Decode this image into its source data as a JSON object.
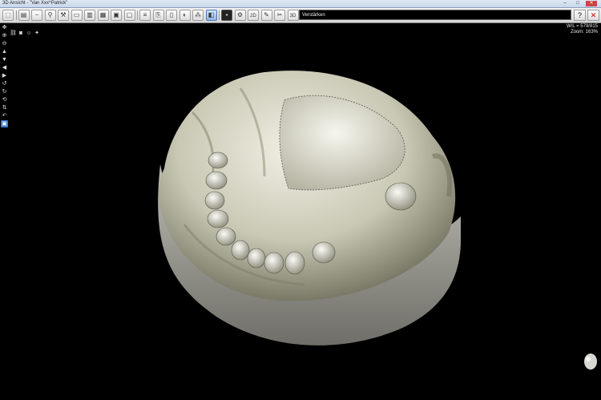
{
  "window": {
    "title": "3D Ansicht - \"Van Xxx^Patrick\""
  },
  "toolbar": {
    "buttons": [
      {
        "name": "select-tool-button",
        "icon": "cursor-icon",
        "glyph": "⬚"
      },
      {
        "name": "layout-button",
        "icon": "layout-icon",
        "glyph": "▤"
      },
      {
        "name": "ruler-button",
        "icon": "ruler-icon",
        "glyph": "⎯"
      },
      {
        "name": "zoom-button",
        "icon": "zoom-icon",
        "glyph": "⚲"
      },
      {
        "name": "tools-button",
        "icon": "wrench-icon",
        "glyph": "⚒"
      },
      {
        "name": "panorama-button",
        "icon": "panorama-icon",
        "glyph": "▭"
      },
      {
        "name": "slice-button",
        "icon": "slice-icon",
        "glyph": "▥"
      },
      {
        "name": "series-button",
        "icon": "series-icon",
        "glyph": "▦"
      },
      {
        "name": "window-button",
        "icon": "window-icon",
        "glyph": "▣"
      },
      {
        "name": "screen-button",
        "icon": "monitor-icon",
        "glyph": "▢"
      },
      {
        "name": "stack-button",
        "icon": "stack-icon",
        "glyph": "≡"
      },
      {
        "name": "export-button",
        "icon": "export-icon",
        "glyph": "⎘"
      },
      {
        "name": "page-button",
        "icon": "page-icon",
        "glyph": "▯"
      },
      {
        "name": "contrast-button",
        "icon": "contrast-icon",
        "glyph": "◐"
      },
      {
        "name": "molecule-button",
        "icon": "molecule-icon",
        "glyph": "⁂"
      },
      {
        "name": "volume-button",
        "icon": "cube-icon",
        "glyph": "◧"
      },
      {
        "name": "preview-button",
        "icon": "thumbnail-icon",
        "glyph": "▪"
      },
      {
        "name": "settings-button",
        "icon": "gear-icon",
        "glyph": "⚙"
      },
      {
        "name": "2d-button",
        "icon": "2d-icon",
        "glyph": "2D"
      },
      {
        "name": "report-button",
        "icon": "report-icon",
        "glyph": "✎"
      },
      {
        "name": "tools2-button",
        "icon": "scissors-icon",
        "glyph": "✂"
      },
      {
        "name": "3d-button",
        "icon": "3d-icon",
        "glyph": "3D"
      }
    ],
    "hint": "Verstärken"
  },
  "right_buttons": {
    "help": "?",
    "close": "✕"
  },
  "side_tools": [
    {
      "name": "arrows-tool",
      "glyph": "✥"
    },
    {
      "name": "zoom-in-tool",
      "glyph": "⊕"
    },
    {
      "name": "zoom-out-tool",
      "glyph": "⊖"
    },
    {
      "name": "up-tool",
      "glyph": "▲"
    },
    {
      "name": "down-tool",
      "glyph": "▼"
    },
    {
      "name": "left-tool",
      "glyph": "◀"
    },
    {
      "name": "right-tool",
      "glyph": "▶"
    },
    {
      "name": "rotate-left-tool",
      "glyph": "↺"
    },
    {
      "name": "rotate-right-tool",
      "glyph": "↻"
    },
    {
      "name": "reset-tool",
      "glyph": "⟲"
    },
    {
      "name": "flip-tool",
      "glyph": "⇅"
    },
    {
      "name": "undo-tool",
      "glyph": "↶"
    },
    {
      "name": "color-tool",
      "glyph": "▣",
      "blue": true
    }
  ],
  "mini_icons": [
    {
      "name": "link-icon",
      "glyph": "⛓"
    },
    {
      "name": "camera-icon",
      "glyph": "◙"
    },
    {
      "name": "person-icon",
      "glyph": "☺"
    },
    {
      "name": "tool-icon",
      "glyph": "✦"
    }
  ],
  "info": {
    "window_level": "W/L = 579/815",
    "zoom": "Zoom: 163%"
  }
}
